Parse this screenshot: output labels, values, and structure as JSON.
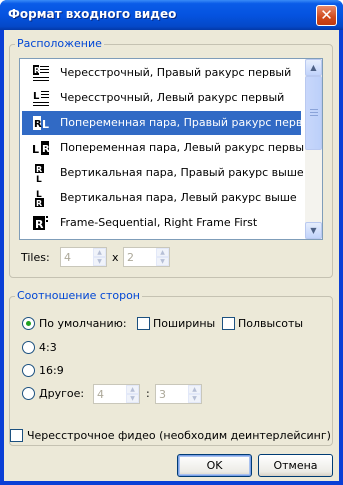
{
  "window": {
    "title": "Формат входного видео",
    "close_glyph": "✕"
  },
  "placement": {
    "legend": "Расположение",
    "items": [
      {
        "label": "Чересстрочный, Правый ракурс первый",
        "icon": "interlaced-right-icon",
        "selected": false
      },
      {
        "label": "Чересстрочный, Левый ракурс первый",
        "icon": "interlaced-left-icon",
        "selected": false
      },
      {
        "label": "Попеременная пара, Правый ракурс первый",
        "icon": "alternating-right-icon",
        "selected": true
      },
      {
        "label": "Попеременная пара, Левый ракурс первый",
        "icon": "alternating-left-icon",
        "selected": false
      },
      {
        "label": "Вертикальная пара, Правый ракурс выше",
        "icon": "vertical-right-icon",
        "selected": false
      },
      {
        "label": "Вертикальная пара, Левый ракурс выше",
        "icon": "vertical-left-icon",
        "selected": false
      },
      {
        "label": "Frame-Sequential, Right Frame First",
        "icon": "frame-sequential-icon",
        "selected": false
      }
    ],
    "tiles_label": "Tiles:",
    "tiles_x": "4",
    "tiles_sep": "x",
    "tiles_y": "2"
  },
  "aspect": {
    "legend": "Соотношение сторон",
    "default_label": "По умолчанию:",
    "half_width_label": "Поширины",
    "half_height_label": "Полвысоты",
    "ratio_4_3": "4:3",
    "ratio_16_9": "16:9",
    "other_label": "Другое:",
    "other_w": "4",
    "other_sep": ":",
    "other_h": "3",
    "selected": "default"
  },
  "interlaced": {
    "label": "Чересстрочное фидео (необходим деинтерлейсинг)"
  },
  "buttons": {
    "ok": "OK",
    "cancel": "Отмена"
  },
  "glyphs": {
    "up": "▲",
    "down": "▼"
  }
}
